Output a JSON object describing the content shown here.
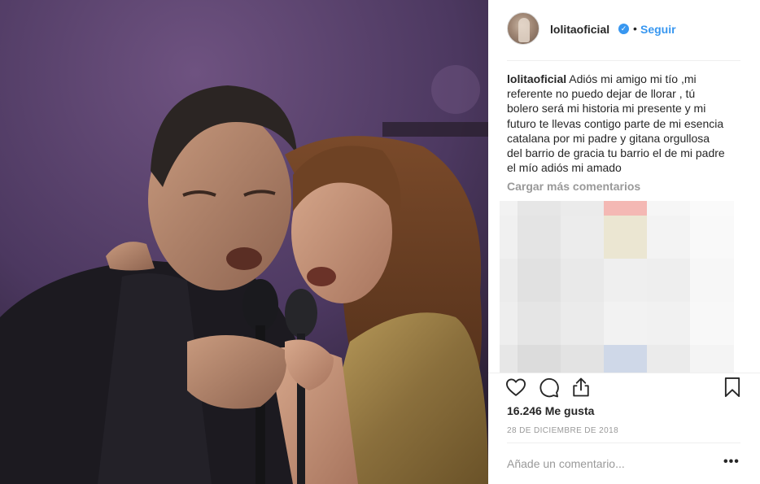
{
  "post": {
    "username": "lolitaoficial",
    "follow_label": "Seguir",
    "separator_dot": "•",
    "verified_glyph": "✓",
    "caption_user": "lolitaoficial",
    "caption_text": "Adiós mi amigo mi tío ,mi referente no puedo dejar de llorar , tú bolero será mi historia mi presente y mi futuro te llevas contigo parte de mi esencia catalana por mi padre y gitana orgullosa del barrio de gracia tu barrio el de mi padre el mío adiós mi amado",
    "load_more_label": "Cargar más comentarios",
    "likes_text": "16.246 Me gusta",
    "date_text": "28 DE DICIEMBRE DE 2018",
    "comment_placeholder": "Añade un comentario...",
    "more_label": "•••"
  },
  "icons": {
    "like": "heart-icon",
    "comment": "comment-icon",
    "share": "share-icon",
    "save": "bookmark-icon",
    "verified": "verified-badge-icon"
  },
  "colors": {
    "link_blue": "#3897f0",
    "text_dark": "#262626",
    "text_gray": "#999999",
    "divider": "#efefef"
  }
}
